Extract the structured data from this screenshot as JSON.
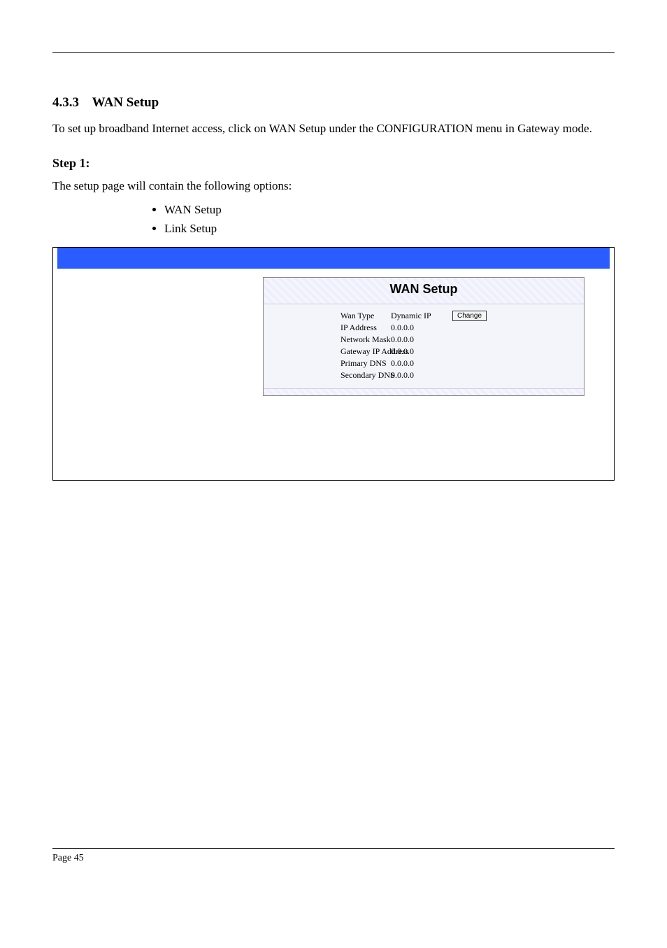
{
  "section_number_line": "4.3.3",
  "section_title": "WAN Setup",
  "intro_text": "To set up broadband Internet access, click on WAN Setup under the CONFIGURATION menu in Gateway mode.",
  "sub_title": "Step 1:",
  "sub_desc": "The setup page will contain the following options:",
  "bullets": [
    "WAN Setup",
    "Link Setup"
  ],
  "wan_setup_title": "WAN Setup",
  "wan_rows": [
    {
      "label": "Wan Type",
      "value": "Dynamic IP",
      "has_button": true
    },
    {
      "label": "IP Address",
      "value": "0.0.0.0",
      "has_button": false
    },
    {
      "label": "Network Mask",
      "value": "0.0.0.0",
      "has_button": false
    },
    {
      "label": "Gateway IP Address",
      "value": "0.0.0.0",
      "has_button": false
    },
    {
      "label": "Primary DNS",
      "value": "0.0.0.0",
      "has_button": false
    },
    {
      "label": "Secondary DNS",
      "value": "0.0.0.0",
      "has_button": false
    }
  ],
  "change_button_label": "Change",
  "page_footer_left": "Page 45",
  "page_footer_right": ""
}
